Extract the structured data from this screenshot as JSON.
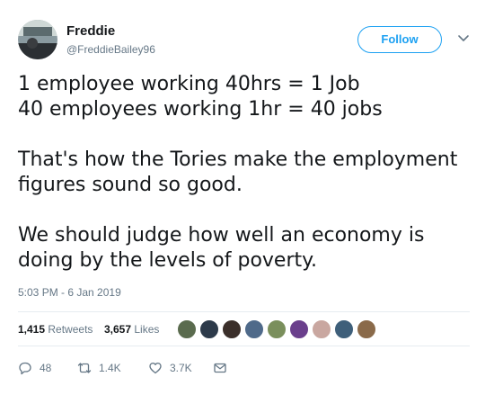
{
  "author": {
    "display_name": "Freddie",
    "handle": "@FreddieBailey96",
    "avatar_icon": "profile-photo"
  },
  "follow_label": "Follow",
  "tweet": {
    "lines_1": [
      "1 employee working 40hrs = 1 Job",
      "40 employees working 1hr = 40 jobs"
    ],
    "lines_2": [
      "That's how the Tories make the employment",
      "figures sound so good."
    ],
    "lines_3": [
      "We should judge how well an economy is",
      "doing by the levels of poverty."
    ]
  },
  "timestamp": "5:03 PM - 6 Jan 2019",
  "stats": {
    "retweets_count": "1,415",
    "retweets_label": "Retweets",
    "likes_count": "3,657",
    "likes_label": "Likes",
    "liker_avatar_colors": [
      "#5a6b4e",
      "#2d3a4a",
      "#3b2f2a",
      "#4f6a8a",
      "#7a8f5c",
      "#6a3f8c",
      "#c9a7a0",
      "#3e5f7a",
      "#8a6a4a"
    ]
  },
  "actions": {
    "reply_count": "48",
    "retweet_count": "1.4K",
    "like_count": "3.7K"
  },
  "colors": {
    "accent": "#1da1f2",
    "muted": "#657786",
    "text": "#14171a",
    "divider": "#e6ecf0"
  }
}
